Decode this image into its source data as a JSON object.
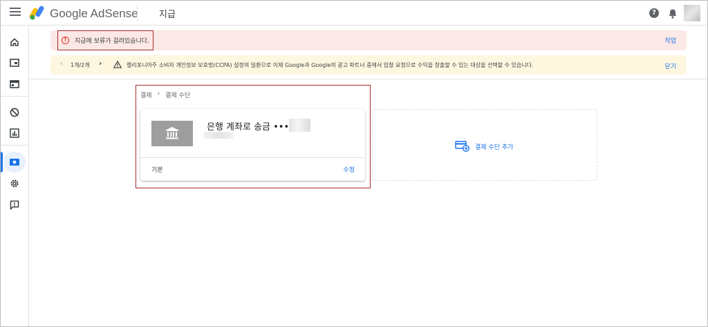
{
  "app": {
    "brand": "Google AdSense",
    "page_title": "지급"
  },
  "header": {
    "help_icon_glyph": "?",
    "help_icon": "help-icon",
    "notifications_icon": "bell-icon",
    "avatar": "account-avatar"
  },
  "rail": {
    "items": [
      {
        "icon": "home-icon"
      },
      {
        "icon": "ads-icon"
      },
      {
        "icon": "sites-icon"
      },
      {
        "icon": "block-icon"
      },
      {
        "icon": "reports-icon"
      },
      {
        "icon": "payments-icon",
        "active": true
      },
      {
        "icon": "settings-icon"
      },
      {
        "icon": "feedback-icon"
      }
    ],
    "accent": "#1a73e8"
  },
  "alerts": {
    "payment_hold": {
      "message": "지급에 보류가 걸려있습니다.",
      "action": "작업",
      "color": "#d93025",
      "icon_glyph": "!"
    },
    "notice": {
      "pager": "1개/2개",
      "prev_glyph": "‹",
      "next_glyph": "›",
      "message": "캘리포니아주 소비자 개인정보 보호법(CCPA) 설정의 일환으로 이제 Google과 Google의 광고 파트너 중에서 입찰 요청으로 수익을 창출할 수 있는 대상을 선택할 수 있습니다.",
      "action": "닫기"
    }
  },
  "breadcrumb": {
    "items": [
      "결제",
      "결제 수단"
    ],
    "separator": "›"
  },
  "payment_method": {
    "title": "은행 계좌로 송금 ••••",
    "default_label": "기본",
    "edit_label": "수정"
  },
  "add_payment": {
    "label": "결제 수단 추가"
  }
}
